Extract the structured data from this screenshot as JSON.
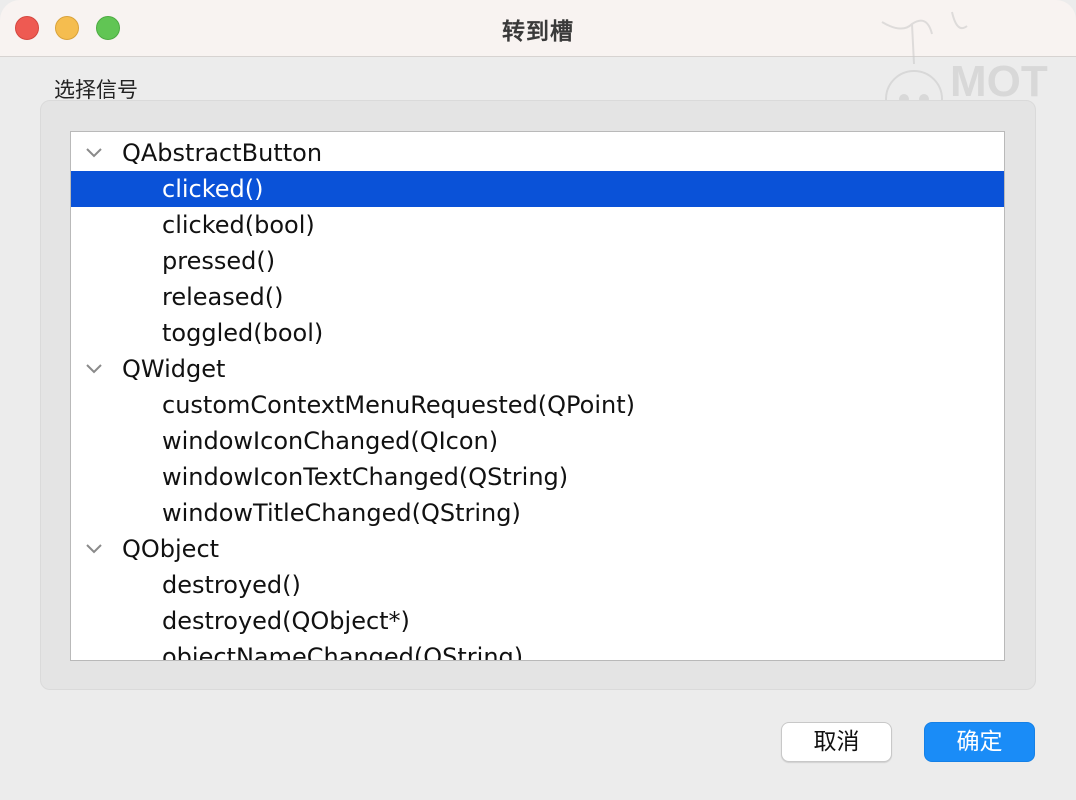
{
  "window": {
    "title": "转到槽"
  },
  "colors": {
    "selection": "#0a52d8",
    "primary_button": "#1a8cf7",
    "close_button": "#ee5a52",
    "minimize_button": "#f5bd4f",
    "zoom_button": "#61c554"
  },
  "signal_group": {
    "label": "选择信号"
  },
  "tree": {
    "rows": [
      {
        "kind": "parent",
        "label": "QAbstractButton",
        "expanded": true,
        "icon": "chevron-down-icon"
      },
      {
        "kind": "child",
        "label": "clicked()",
        "selected": true
      },
      {
        "kind": "child",
        "label": "clicked(bool)"
      },
      {
        "kind": "child",
        "label": "pressed()"
      },
      {
        "kind": "child",
        "label": "released()"
      },
      {
        "kind": "child",
        "label": "toggled(bool)"
      },
      {
        "kind": "parent",
        "label": "QWidget",
        "expanded": true,
        "icon": "chevron-down-icon"
      },
      {
        "kind": "child",
        "label": "customContextMenuRequested(QPoint)"
      },
      {
        "kind": "child",
        "label": "windowIconChanged(QIcon)"
      },
      {
        "kind": "child",
        "label": "windowIconTextChanged(QString)"
      },
      {
        "kind": "child",
        "label": "windowTitleChanged(QString)"
      },
      {
        "kind": "parent",
        "label": "QObject",
        "expanded": true,
        "icon": "chevron-down-icon"
      },
      {
        "kind": "child",
        "label": "destroyed()"
      },
      {
        "kind": "child",
        "label": "destroyed(QObject*)"
      },
      {
        "kind": "child",
        "label": "objectNameChanged(QString)"
      }
    ]
  },
  "buttons": {
    "cancel_label": "取消",
    "ok_label": "确定"
  },
  "watermark": {
    "logo_text": "MOT"
  }
}
